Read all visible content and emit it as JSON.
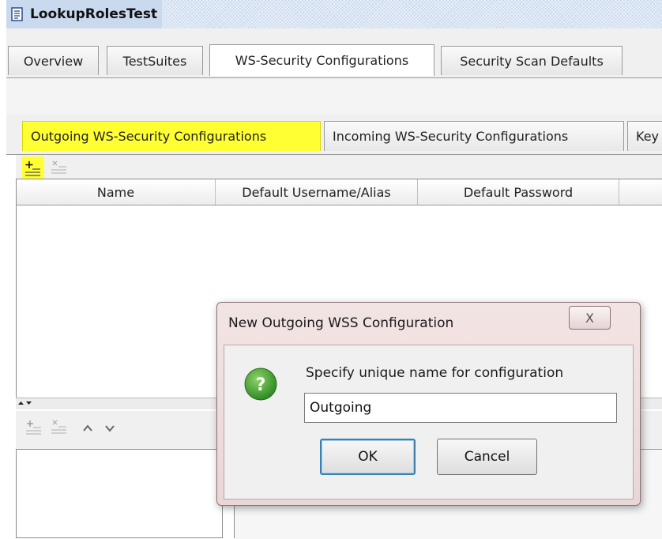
{
  "window": {
    "title": "LookupRolesTest",
    "icon": "document-icon"
  },
  "top_tabs": [
    {
      "label": "Overview",
      "active": false
    },
    {
      "label": "TestSuites",
      "active": false
    },
    {
      "label": "WS-Security Configurations",
      "active": true
    },
    {
      "label": "Security Scan Defaults",
      "active": false
    }
  ],
  "sub_tabs": [
    {
      "label": "Outgoing WS-Security Configurations",
      "highlighted": true
    },
    {
      "label": "Incoming WS-Security Configurations",
      "highlighted": false
    },
    {
      "label": "Key",
      "highlighted": false
    }
  ],
  "toolbar": {
    "add_icon": "add-configuration-icon",
    "remove_icon": "remove-configuration-icon",
    "highlight_color": "#ffff33"
  },
  "table": {
    "columns": [
      "Name",
      "Default Username/Alias",
      "Default Password"
    ],
    "rows": []
  },
  "entries_toolbar": {
    "icons": [
      "add-entry-icon",
      "remove-entry-icon",
      "move-up-icon",
      "move-down-icon"
    ]
  },
  "dialog": {
    "title": "New Outgoing WSS Configuration",
    "close_symbol": "X",
    "message": "Specify unique name for configuration",
    "input_value": "Outgoing",
    "ok_label": "OK",
    "cancel_label": "Cancel",
    "icon": "question-icon",
    "icon_color": "#3f9e2d"
  }
}
